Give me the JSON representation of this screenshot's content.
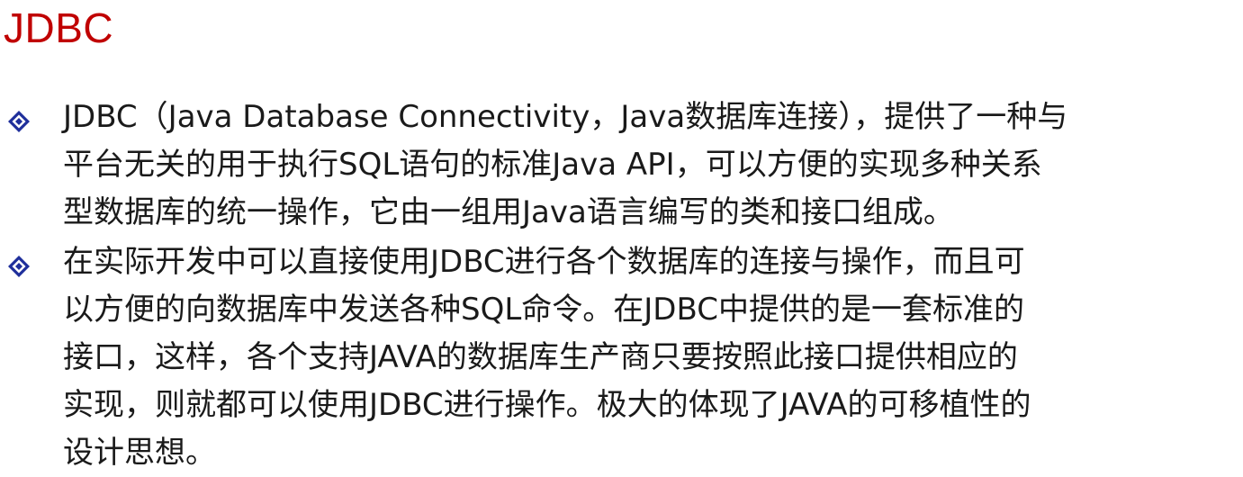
{
  "slide": {
    "title": "JDBC",
    "title_color": "#c00000",
    "bullet_icon": "diamond-bullet-icon",
    "bullet_color": "#1f2f9b",
    "bullets": [
      {
        "lines": [
          "JDBC（Java Database Connectivity，Java数据库连接），提供了一种与",
          "平台无关的用于执行SQL语句的标准Java API，可以方便的实现多种关系",
          "型数据库的统一操作，它由一组用Java语言编写的类和接口组成。"
        ]
      },
      {
        "lines": [
          "在实际开发中可以直接使用JDBC进行各个数据库的连接与操作，而且可",
          "以方便的向数据库中发送各种SQL命令。在JDBC中提供的是一套标准的",
          "接口，这样，各个支持JAVA的数据库生产商只要按照此接口提供相应的",
          "实现，则就都可以使用JDBC进行操作。极大的体现了JAVA的可移植性的",
          "设计思想。"
        ]
      }
    ]
  }
}
